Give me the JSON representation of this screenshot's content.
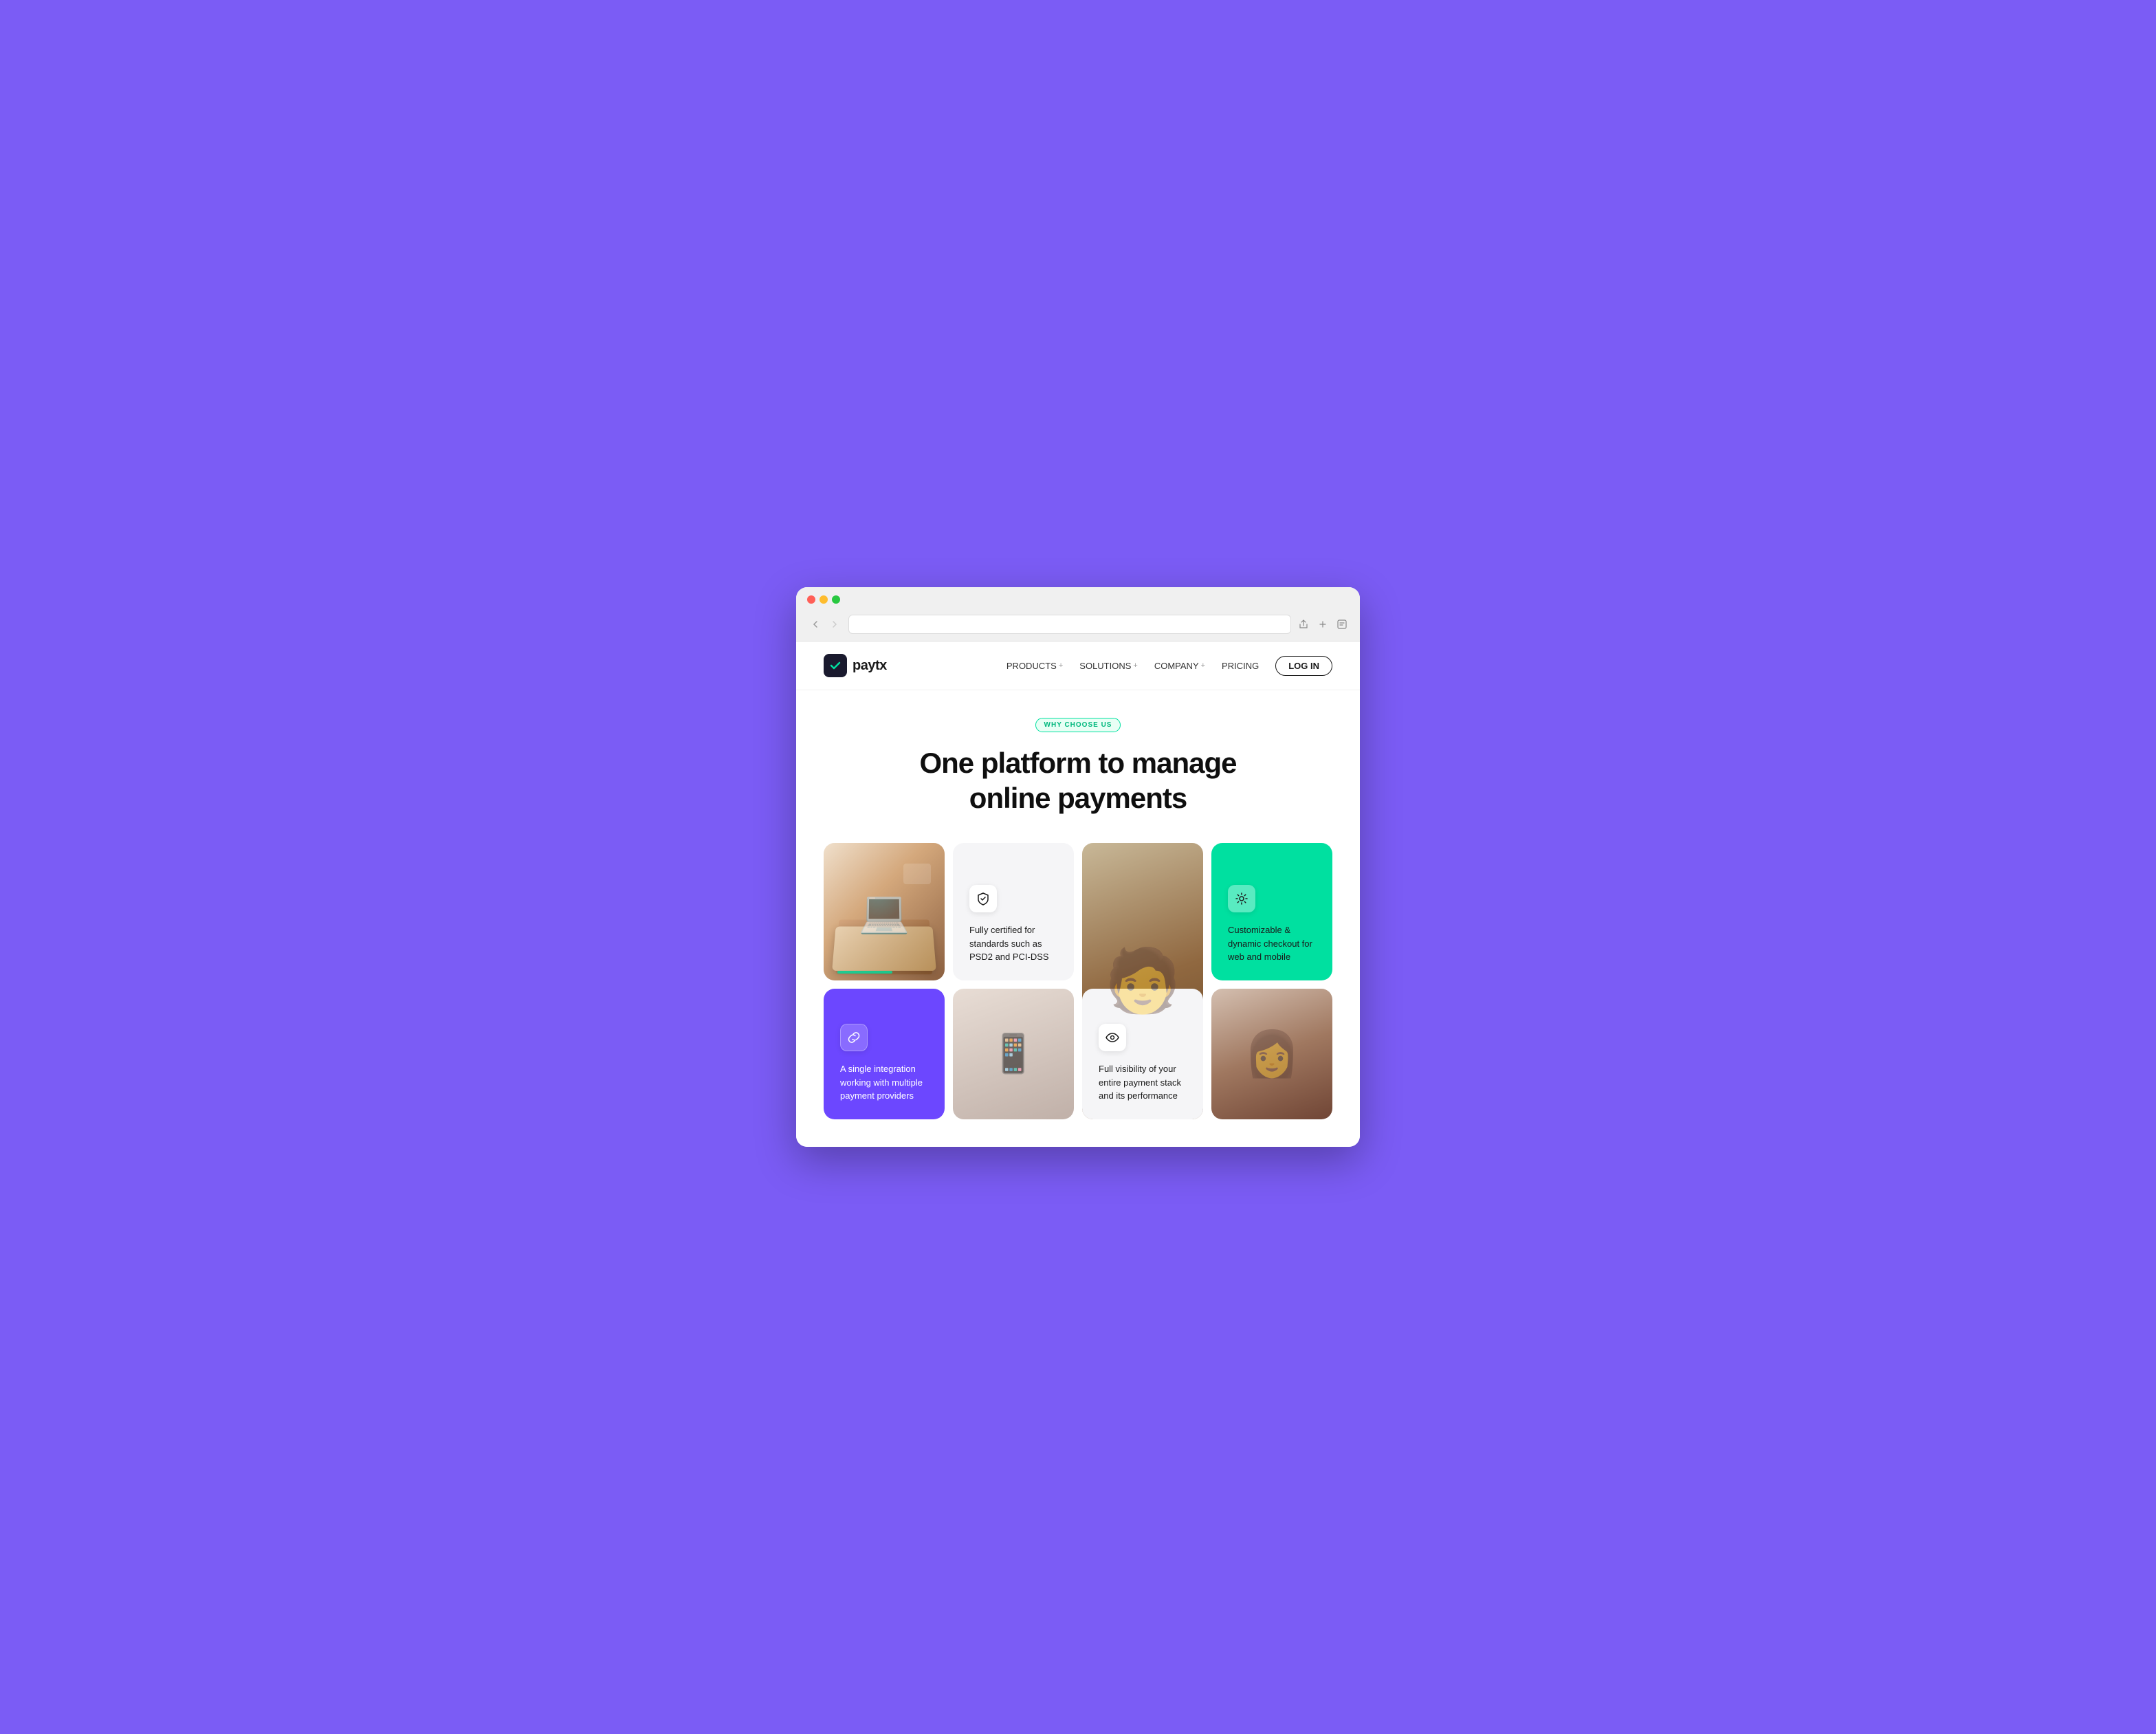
{
  "browser": {
    "dots": [
      "red",
      "yellow",
      "green"
    ]
  },
  "navbar": {
    "logo_text": "paytx",
    "nav_items": [
      {
        "label": "PRODUCTS",
        "has_plus": true
      },
      {
        "label": "SOLUTIONS",
        "has_plus": true
      },
      {
        "label": "COMPANY",
        "has_plus": true
      },
      {
        "label": "PRICING",
        "has_plus": false
      }
    ],
    "login_label": "LOG IN"
  },
  "hero": {
    "badge": "WHY CHOOSE US",
    "title_line1": "One platform to manage",
    "title_line2": "online payments"
  },
  "cards": {
    "certified": {
      "text": "Fully certified for standards such as PSD2 and PCI-DSS"
    },
    "customizable": {
      "text": "Customizable & dynamic checkout for web and mobile"
    },
    "integration": {
      "text": "A single integration working with multiple payment providers"
    },
    "visibility": {
      "text": "Full visibility of your entire payment stack and its performance"
    }
  },
  "colors": {
    "accent_teal": "#00e0a0",
    "accent_purple": "#6c47ff",
    "bg_light": "#f5f5f7",
    "text_dark": "#1a1a1a",
    "text_white": "#ffffff"
  }
}
